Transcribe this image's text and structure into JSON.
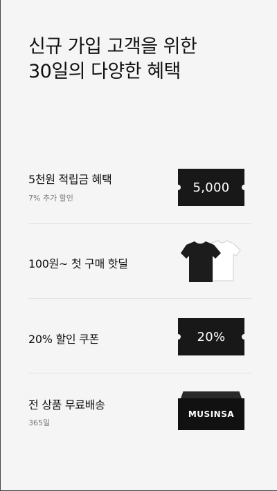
{
  "headline": {
    "line1": "신규 가입 고객을 위한",
    "line2": "30일의 다양한 혜택"
  },
  "benefits": [
    {
      "label": "5천원 적립금 혜택",
      "sub": "7% 추가 할인",
      "ticket": "5,000"
    },
    {
      "label": "100원~ 첫 구매 핫딜",
      "sub": "",
      "icon": "tshirts-icon"
    },
    {
      "label": "20% 할인 쿠폰",
      "sub": "",
      "ticket": "20%"
    },
    {
      "label": "전 상품 무료배송",
      "sub": "365일",
      "box": "MUSINSA"
    }
  ],
  "colors": {
    "background": "#f5f5f5",
    "ticket": "#181818",
    "divider": "#e0e0e0"
  }
}
